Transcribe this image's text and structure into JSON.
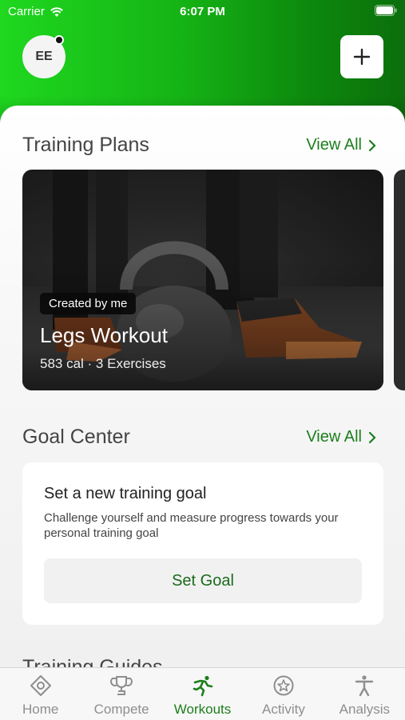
{
  "status_bar": {
    "carrier": "Carrier",
    "time": "6:07 PM"
  },
  "header": {
    "avatar_initials": "EE"
  },
  "training_plans": {
    "title": "Training Plans",
    "view_all": "View All",
    "card": {
      "badge": "Created by me",
      "title": "Legs Workout",
      "meta": "583 cal · 3 Exercises"
    }
  },
  "goal_center": {
    "title": "Goal Center",
    "view_all": "View All",
    "card": {
      "title": "Set a new training goal",
      "description": "Challenge yourself and measure progress towards your personal training goal",
      "button": "Set Goal"
    }
  },
  "next_section_peek": "Training Guides",
  "tabs": [
    {
      "label": "Home",
      "icon": "home-icon",
      "active": false
    },
    {
      "label": "Compete",
      "icon": "trophy-icon",
      "active": false
    },
    {
      "label": "Workouts",
      "icon": "workouts-icon",
      "active": true
    },
    {
      "label": "Activity",
      "icon": "activity-icon",
      "active": false
    },
    {
      "label": "Analysis",
      "icon": "analysis-icon",
      "active": false
    }
  ],
  "colors": {
    "accent": "#1c7e1c",
    "gradient_start": "#1fd81f",
    "gradient_end": "#0b6f0b"
  }
}
